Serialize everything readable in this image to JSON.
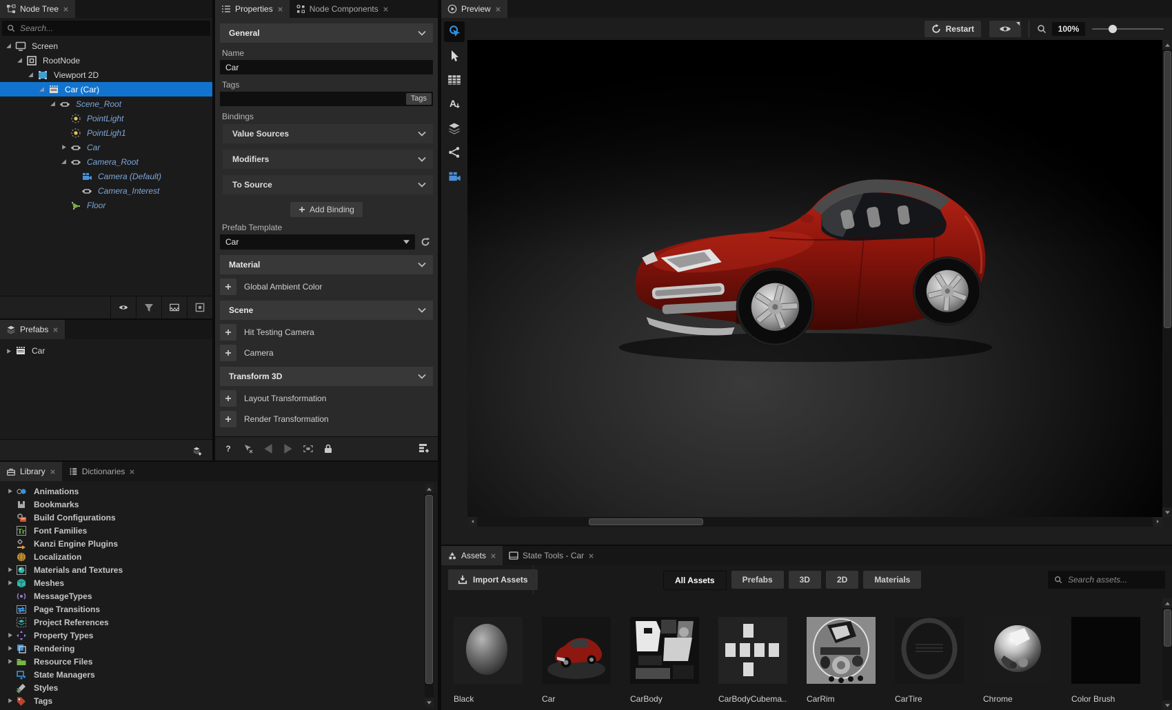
{
  "theme": {
    "accent": "#1273cf",
    "instance_item_color": "#7da7d9",
    "panel_bg": "#2a2a2a",
    "dark_bg": "#1b1b1b",
    "viewport_bg": "#000000",
    "car_color": "#8c150c"
  },
  "node_tree": {
    "tab_label": "Node Tree",
    "search_placeholder": "Search...",
    "items": [
      {
        "label": "Screen",
        "depth": 0,
        "icon": "screen-icon",
        "expander": "open",
        "variant": "normal"
      },
      {
        "label": "RootNode",
        "depth": 1,
        "icon": "rootnode-icon",
        "expander": "open",
        "variant": "normal"
      },
      {
        "label": "Viewport 2D",
        "depth": 2,
        "icon": "viewport-icon",
        "expander": "open",
        "variant": "normal"
      },
      {
        "label": "Car (Car)",
        "depth": 3,
        "icon": "prefab-icon",
        "expander": "open",
        "variant": "selected"
      },
      {
        "label": "Scene_Root",
        "depth": 4,
        "icon": "node3d-icon",
        "expander": "open",
        "variant": "instance"
      },
      {
        "label": "PointLight",
        "depth": 5,
        "icon": "light-icon",
        "expander": "none",
        "variant": "instance"
      },
      {
        "label": "PointLigh1",
        "depth": 5,
        "icon": "light-icon",
        "expander": "none",
        "variant": "instance"
      },
      {
        "label": "Car",
        "depth": 5,
        "icon": "node3d-icon",
        "expander": "closed",
        "variant": "instance"
      },
      {
        "label": "Camera_Root",
        "depth": 5,
        "icon": "node3d-icon",
        "expander": "open",
        "variant": "instance"
      },
      {
        "label": "Camera (Default)",
        "depth": 6,
        "icon": "video-camera-icon",
        "expander": "none",
        "variant": "instance"
      },
      {
        "label": "Camera_Interest",
        "depth": 6,
        "icon": "node3d-icon",
        "expander": "none",
        "variant": "instance"
      },
      {
        "label": "Floor",
        "depth": 5,
        "icon": "floor-icon",
        "expander": "none",
        "variant": "instance"
      }
    ],
    "toolbar": [
      {
        "name": "visibility-button",
        "icon": "eye-icon"
      },
      {
        "name": "filter-button",
        "icon": "filter-icon"
      },
      {
        "name": "checker-button",
        "icon": "checker-icon"
      },
      {
        "name": "options-button",
        "icon": "small-box-icon"
      }
    ]
  },
  "prefabs": {
    "tab_label": "Prefabs",
    "items": [
      {
        "label": "Car",
        "icon": "prefab-icon",
        "expander": "closed"
      }
    ],
    "toolbar": [
      {
        "name": "add-prefab-button",
        "icon": "layers-plus-icon"
      }
    ]
  },
  "properties": {
    "tab_properties": "Properties",
    "tab_node_components": "Node Components",
    "general_header": "General",
    "name_label": "Name",
    "name_value": "Car",
    "tags_label": "Tags",
    "tags_value": "",
    "tags_button": "Tags",
    "bindings_label": "Bindings",
    "binding_groups": [
      "Value Sources",
      "Modifiers",
      "To Source"
    ],
    "add_binding_label": "Add Binding",
    "prefab_template_label": "Prefab Template",
    "prefab_template_value": "Car",
    "material_header": "Material",
    "material_add_rows": [
      "Global Ambient Color"
    ],
    "scene_header": "Scene",
    "scene_add_rows": [
      "Hit Testing Camera",
      "Camera"
    ],
    "transform_header": "Transform 3D",
    "transform_add_rows": [
      "Layout Transformation",
      "Render Transformation"
    ],
    "toolbar": [
      {
        "name": "help-button",
        "icon": "help-icon"
      },
      {
        "name": "pointer-button",
        "icon": "pointer-x-icon"
      },
      {
        "name": "back-button",
        "icon": "nav-back-icon"
      },
      {
        "name": "forward-button",
        "icon": "nav-forward-icon"
      },
      {
        "name": "focus-frame-button",
        "icon": "focus-frame-icon"
      },
      {
        "name": "lock-button",
        "icon": "lock-icon"
      }
    ],
    "toolbar_right": [
      {
        "name": "add-property-button",
        "icon": "add-property-icon"
      }
    ]
  },
  "library": {
    "tab_library": "Library",
    "tab_dictionaries": "Dictionaries",
    "items": [
      {
        "label": "Animations",
        "icon": "animations-icon",
        "expandable": true
      },
      {
        "label": "Bookmarks",
        "icon": "bookmarks-icon",
        "expandable": false
      },
      {
        "label": "Build Configurations",
        "icon": "build-configurations-icon",
        "expandable": false
      },
      {
        "label": "Font Families",
        "icon": "font-families-icon",
        "expandable": false
      },
      {
        "label": "Kanzi Engine Plugins",
        "icon": "plugins-icon",
        "expandable": false
      },
      {
        "label": "Localization",
        "icon": "localization-icon",
        "expandable": false
      },
      {
        "label": "Materials and Textures",
        "icon": "materials-icon",
        "expandable": true
      },
      {
        "label": "Meshes",
        "icon": "meshes-icon",
        "expandable": true
      },
      {
        "label": "MessageTypes",
        "icon": "message-types-icon",
        "expandable": false
      },
      {
        "label": "Page Transitions",
        "icon": "page-transitions-icon",
        "expandable": false
      },
      {
        "label": "Project References",
        "icon": "project-references-icon",
        "expandable": false
      },
      {
        "label": "Property Types",
        "icon": "property-types-icon",
        "expandable": true
      },
      {
        "label": "Rendering",
        "icon": "rendering-icon",
        "expandable": true
      },
      {
        "label": "Resource Files",
        "icon": "resource-files-icon",
        "expandable": true
      },
      {
        "label": "State Managers",
        "icon": "state-managers-icon",
        "expandable": false
      },
      {
        "label": "Styles",
        "icon": "styles-icon",
        "expandable": false
      },
      {
        "label": "Tags",
        "icon": "tags-icon",
        "expandable": true
      }
    ]
  },
  "preview": {
    "tab_label": "Preview",
    "restart_label": "Restart",
    "zoom_value": "100%",
    "tools": [
      {
        "name": "interact-tool",
        "icon": "interact-icon",
        "selected": true
      },
      {
        "name": "select-tool",
        "icon": "select-icon",
        "selected": false
      },
      {
        "name": "grid-tool",
        "icon": "grid-icon",
        "selected": false
      },
      {
        "name": "text-tool",
        "icon": "text-style-icon",
        "selected": false
      },
      {
        "name": "layers-tool",
        "icon": "layers-icon",
        "selected": false
      },
      {
        "name": "connections-tool",
        "icon": "connections-icon",
        "selected": false
      },
      {
        "name": "camera-tool",
        "icon": "video-camera-icon",
        "selected": false
      }
    ]
  },
  "assets": {
    "tab_assets": "Assets",
    "tab_state_tools": "State Tools - Car",
    "import_label": "Import Assets",
    "filters": [
      {
        "label": "All Assets",
        "active": true
      },
      {
        "label": "Prefabs",
        "active": false
      },
      {
        "label": "3D",
        "active": false
      },
      {
        "label": "2D",
        "active": false
      },
      {
        "label": "Materials",
        "active": false
      }
    ],
    "search_placeholder": "Search assets...",
    "items": [
      {
        "label": "Black",
        "thumb": "sphere-dark"
      },
      {
        "label": "Car",
        "thumb": "car"
      },
      {
        "label": "CarBody",
        "thumb": "body-texture"
      },
      {
        "label": "CarBodyCubema...",
        "thumb": "cubemap"
      },
      {
        "label": "CarRim",
        "thumb": "rim-texture"
      },
      {
        "label": "CarTire",
        "thumb": "tire-texture"
      },
      {
        "label": "Chrome",
        "thumb": "sphere-chrome"
      },
      {
        "label": "Color Brush",
        "thumb": "black"
      }
    ]
  }
}
